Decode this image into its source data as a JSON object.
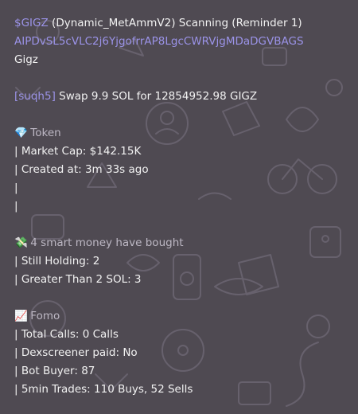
{
  "header": {
    "ticker_link": "$GIGZ",
    "header_rest": "(Dynamic_MetAmmV2) Scanning (Reminder 1)",
    "contract_address": "AIPDvSL5cVLC2j6YjgofrrAP8LgcCWRVjgMDaDGVBAGS",
    "token_name": "Gigz"
  },
  "swap": {
    "wallet_link": "[suqh5]",
    "text": "Swap 9.9 SOL for 12854952.98 GIGZ"
  },
  "token_section": {
    "icon": "gem-icon",
    "icon_glyph": "💎",
    "title": "Token",
    "market_cap": "| Market Cap: $142.15K",
    "created_at": "| Created at: 3m 33s ago",
    "blank1": "|",
    "blank2": "|"
  },
  "smart_money": {
    "icon": "money-wings-icon",
    "icon_glyph": "💸",
    "title": "4 smart money have bought",
    "still_holding": "| Still Holding: 2",
    "greater_than": "| Greater Than 2 SOL: 3"
  },
  "fomo": {
    "icon": "chart-up-icon",
    "icon_glyph": "📈",
    "title": "Fomo",
    "total_calls": "| Total Calls: 0 Calls",
    "dexscreener": "| Dexscreener paid: No",
    "bot_buyer": "| Bot Buyer: 87",
    "trades": "| 5min Trades: 110 Buys, 52 Sells"
  },
  "colors": {
    "background": "#4f4a52",
    "link": "#9b93e8",
    "text": "#f2f2f2",
    "muted": "#bdb8c4"
  }
}
